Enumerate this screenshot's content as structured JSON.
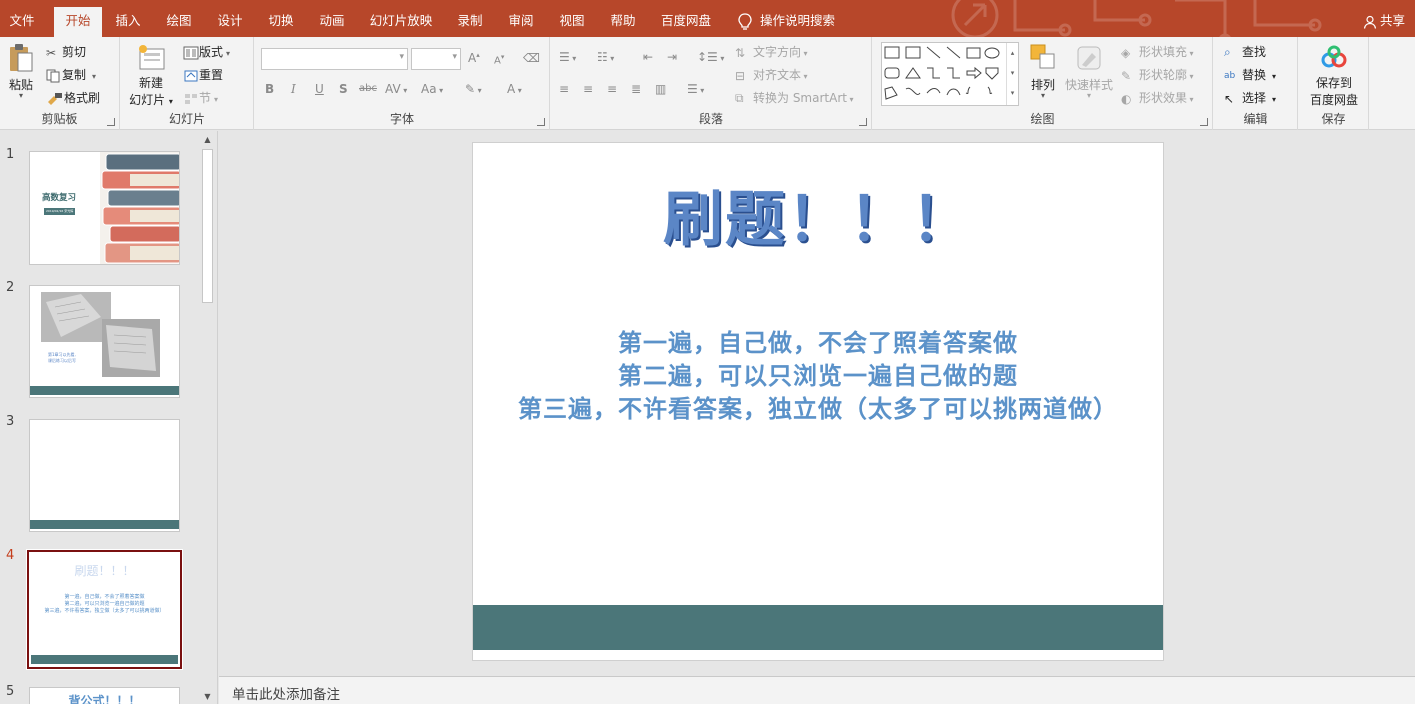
{
  "tabs": [
    "文件",
    "开始",
    "插入",
    "绘图",
    "设计",
    "切换",
    "动画",
    "幻灯片放映",
    "录制",
    "审阅",
    "视图",
    "帮助",
    "百度网盘"
  ],
  "active_tab": "开始",
  "tell_me": "操作说明搜索",
  "share": "共享",
  "ribbon": {
    "clipboard": {
      "label": "剪贴板",
      "paste": "粘贴",
      "cut": "剪切",
      "copy": "复制",
      "format_painter": "格式刷"
    },
    "slides": {
      "label": "幻灯片",
      "new_slide_line1": "新建",
      "new_slide_line2": "幻灯片",
      "layout": "版式",
      "reset": "重置",
      "section": "节"
    },
    "font": {
      "label": "字体",
      "font_name": "",
      "font_size": ""
    },
    "paragraph": {
      "label": "段落",
      "text_direction": "文字方向",
      "align_text": "对齐文本",
      "convert_smartart": "转换为 SmartArt"
    },
    "drawing": {
      "label": "绘图",
      "arrange": "排列",
      "quick_styles": "快速样式",
      "shape_fill": "形状填充",
      "shape_outline": "形状轮廓",
      "shape_effects": "形状效果"
    },
    "editing": {
      "label": "编辑",
      "find": "查找",
      "replace": "替换",
      "select": "选择"
    },
    "save": {
      "label": "保存",
      "save_to_line1": "保存到",
      "save_to_line2": "百度网盘"
    }
  },
  "thumbnails": [
    {
      "num": "1",
      "title": "高数复习",
      "subtitle": "2019/02/16 宋光辉"
    },
    {
      "num": "2",
      "text_line1": "第1章习以先看,",
      "text_line2": "课后练习以后写"
    },
    {
      "num": "3"
    },
    {
      "num": "4",
      "title": "刷题！！！",
      "line1": "第一遍，自己做，不会了照着答案做",
      "line2": "第二遍，可以只浏览一遍自己做的题",
      "line3": "第三遍，不许看答案，独立做（太多了可以挑两道做）"
    },
    {
      "num": "5",
      "title": "背公式！！！"
    }
  ],
  "current_slide": {
    "title": "刷题！！！",
    "lines": [
      "第一遍，自己做，不会了照着答案做",
      "第二遍，可以只浏览一遍自己做的题",
      "第三遍，不许看答案，独立做（太多了可以挑两道做）"
    ]
  },
  "notes_placeholder": "单击此处添加备注",
  "colors": {
    "accent": "#b7472a",
    "band": "#4b7679",
    "title": "#5b86c6",
    "body": "#5b92c9"
  }
}
